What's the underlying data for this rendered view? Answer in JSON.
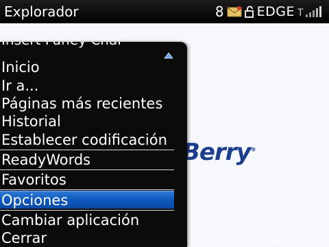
{
  "status_bar": {
    "app_title": "Explorador",
    "message_count": "8",
    "network": "EDGE"
  },
  "page": {
    "brand_text": "Berry",
    "brand_mark": "®",
    "watermark": "Digitale.com"
  },
  "menu": {
    "clipped_item": "Insert Paney Chai",
    "items": [
      "Inicio",
      "Ir a...",
      "Páginas más recientes",
      "Historial",
      "Establecer codificación",
      "ReadyWords",
      "Favoritos",
      "Opciones",
      "Cambiar aplicación",
      "Cerrar"
    ],
    "selected_item": "Opciones"
  },
  "colors": {
    "status_bar_bg": "#000000",
    "menu_bg": "#0b0b0b",
    "selection": "#0f5bbf",
    "brand": "#1d3d8e"
  },
  "icons": [
    "envelope-icon",
    "lock-icon",
    "signal-strength-icon",
    "scroll-up-icon"
  ]
}
